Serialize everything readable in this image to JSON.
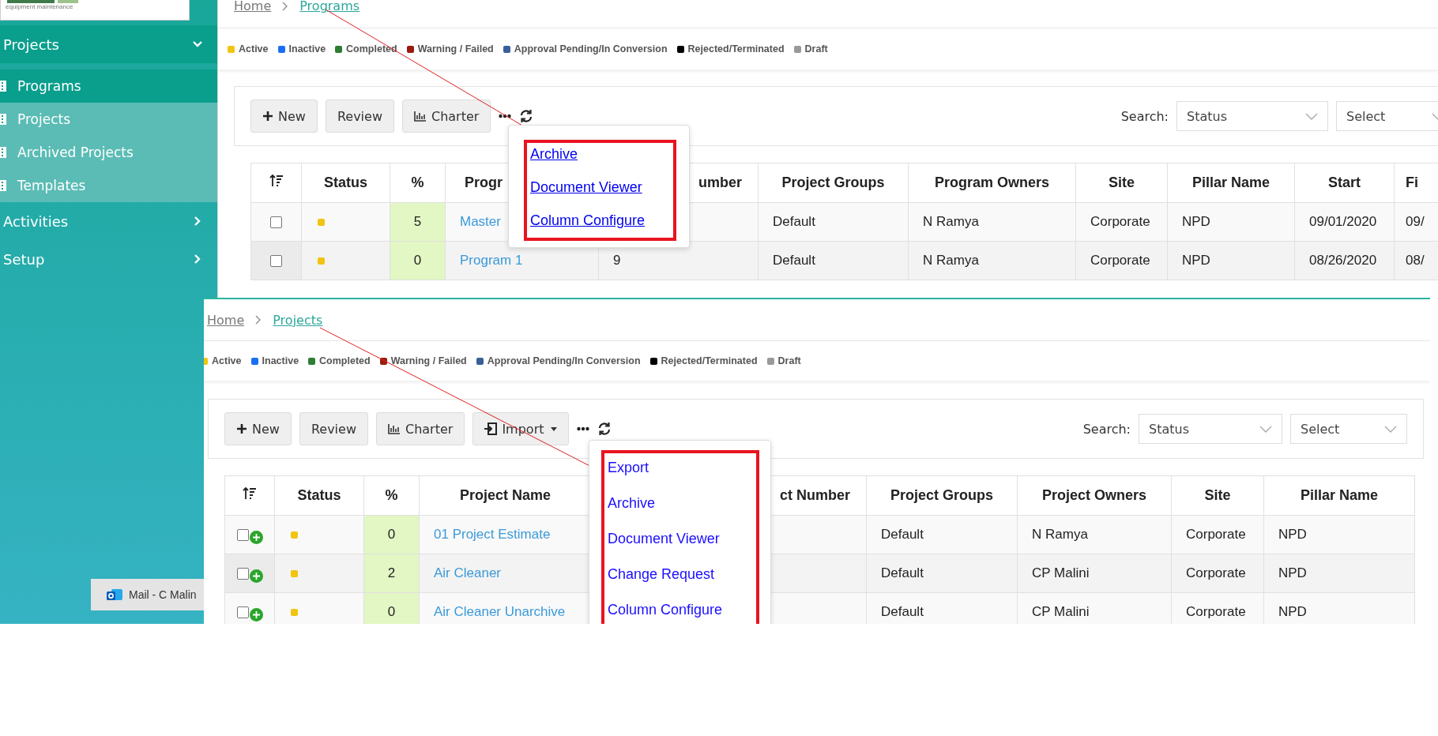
{
  "sidebar": {
    "logo_caption": "equipment maintenance",
    "menu": [
      {
        "label": "Projects",
        "expanded": true,
        "children": [
          {
            "label": "Programs",
            "selected": true
          },
          {
            "label": "Projects",
            "selected": false
          },
          {
            "label": "Archived Projects",
            "selected": false
          },
          {
            "label": "Templates",
            "selected": false
          }
        ]
      },
      {
        "label": "Activities",
        "expanded": false
      },
      {
        "label": "Setup",
        "expanded": false
      }
    ]
  },
  "screens": [
    {
      "breadcrumb": [
        {
          "label": "Home",
          "selected": false
        },
        {
          "label": "Programs",
          "selected": true
        }
      ],
      "legend": [
        {
          "label": "Active",
          "color": "#f1c40f"
        },
        {
          "label": "Inactive",
          "color": "#1a6ef5"
        },
        {
          "label": "Completed",
          "color": "#2e7d32"
        },
        {
          "label": "Warning / Failed",
          "color": "#9b1b10"
        },
        {
          "label": "Approval Pending/In Conversion",
          "color": "#3a5f9a"
        },
        {
          "label": "Rejected/Terminated",
          "color": "#000000"
        },
        {
          "label": "Draft",
          "color": "#999999"
        }
      ],
      "toolbar": [
        {
          "kind": "add",
          "label": "New"
        },
        {
          "kind": "plain",
          "label": "Review"
        },
        {
          "kind": "chart",
          "label": "Charter"
        }
      ],
      "search": {
        "label": "Search:",
        "filters": [
          "Status",
          "Select"
        ]
      },
      "menu": [
        "Archive",
        "Document Viewer",
        "Column Configure"
      ],
      "table": {
        "columns": [
          {
            "kind": "select"
          },
          {
            "label": "Status",
            "kind": "status"
          },
          {
            "label": "%",
            "kind": "percent"
          },
          {
            "label": "Progr",
            "kind": "link"
          },
          {
            "label": "umber",
            "kind": "text"
          },
          {
            "label": "Project Groups",
            "kind": "text"
          },
          {
            "label": "Program Owners",
            "kind": "text"
          },
          {
            "label": "Site",
            "kind": "text"
          },
          {
            "label": "Pillar Name",
            "kind": "text"
          },
          {
            "label": "Start",
            "kind": "text"
          },
          {
            "label": "Fi",
            "kind": "text"
          }
        ],
        "rows": [
          {
            "checked": false,
            "expandable": false,
            "color": "#f1c40f",
            "cells": [
              "",
              "",
              "5",
              "Master",
              "",
              "Default",
              "N Ramya",
              "Corporate",
              "NPD",
              "09/01/2020",
              "09/"
            ]
          },
          {
            "checked": false,
            "expandable": false,
            "color": "#f1c40f",
            "cells": [
              "",
              "",
              "0",
              "Program 1",
              "9",
              "Default",
              "N Ramya",
              "Corporate",
              "NPD",
              "08/26/2020",
              "08/"
            ]
          }
        ]
      }
    },
    {
      "breadcrumb": [
        {
          "label": "Home",
          "selected": false
        },
        {
          "label": "Projects",
          "selected": true
        }
      ],
      "legend": [
        {
          "label": "Active",
          "color": "#f1c40f"
        },
        {
          "label": "Inactive",
          "color": "#1a6ef5"
        },
        {
          "label": "Completed",
          "color": "#2e7d32"
        },
        {
          "label": "Warning / Failed",
          "color": "#9b1b10"
        },
        {
          "label": "Approval Pending/In Conversion",
          "color": "#3a5f9a"
        },
        {
          "label": "Rejected/Terminated",
          "color": "#000000"
        },
        {
          "label": "Draft",
          "color": "#999999"
        }
      ],
      "toolbar": [
        {
          "kind": "add",
          "label": "New"
        },
        {
          "kind": "plain",
          "label": "Review"
        },
        {
          "kind": "chart",
          "label": "Charter"
        },
        {
          "kind": "import",
          "label": "Import"
        }
      ],
      "search": {
        "label": "Search:",
        "filters": [
          "Status",
          "Select"
        ]
      },
      "menu": [
        "Export",
        "Archive",
        "Document Viewer",
        "Change Request",
        "Column Configure"
      ],
      "table": {
        "columns": [
          {
            "kind": "select"
          },
          {
            "label": "Status",
            "kind": "status"
          },
          {
            "label": "%",
            "kind": "percent"
          },
          {
            "label": "Project Name",
            "kind": "link"
          },
          {
            "label": "ct Number",
            "kind": "text"
          },
          {
            "label": "Project Groups",
            "kind": "text"
          },
          {
            "label": "Project Owners",
            "kind": "text"
          },
          {
            "label": "Site",
            "kind": "text"
          },
          {
            "label": "Pillar Name",
            "kind": "text"
          }
        ],
        "rows": [
          {
            "checked": false,
            "expandable": true,
            "color": "#f1c40f",
            "cells": [
              "",
              "",
              "0",
              "01 Project Estimate",
              "",
              "Default",
              "N Ramya",
              "Corporate",
              "NPD"
            ]
          },
          {
            "checked": false,
            "expandable": true,
            "color": "#f1c40f",
            "cells": [
              "",
              "",
              "2",
              "Air Cleaner",
              "",
              "Default",
              "CP Malini",
              "Corporate",
              "NPD"
            ]
          },
          {
            "checked": false,
            "expandable": true,
            "color": "#f1c40f",
            "cells": [
              "",
              "",
              "0",
              "Air Cleaner Unarchive",
              "",
              "Default",
              "CP Malini",
              "Corporate",
              "NPD"
            ]
          }
        ]
      }
    }
  ],
  "taskbar": {
    "label": "Mail - C Malin"
  }
}
